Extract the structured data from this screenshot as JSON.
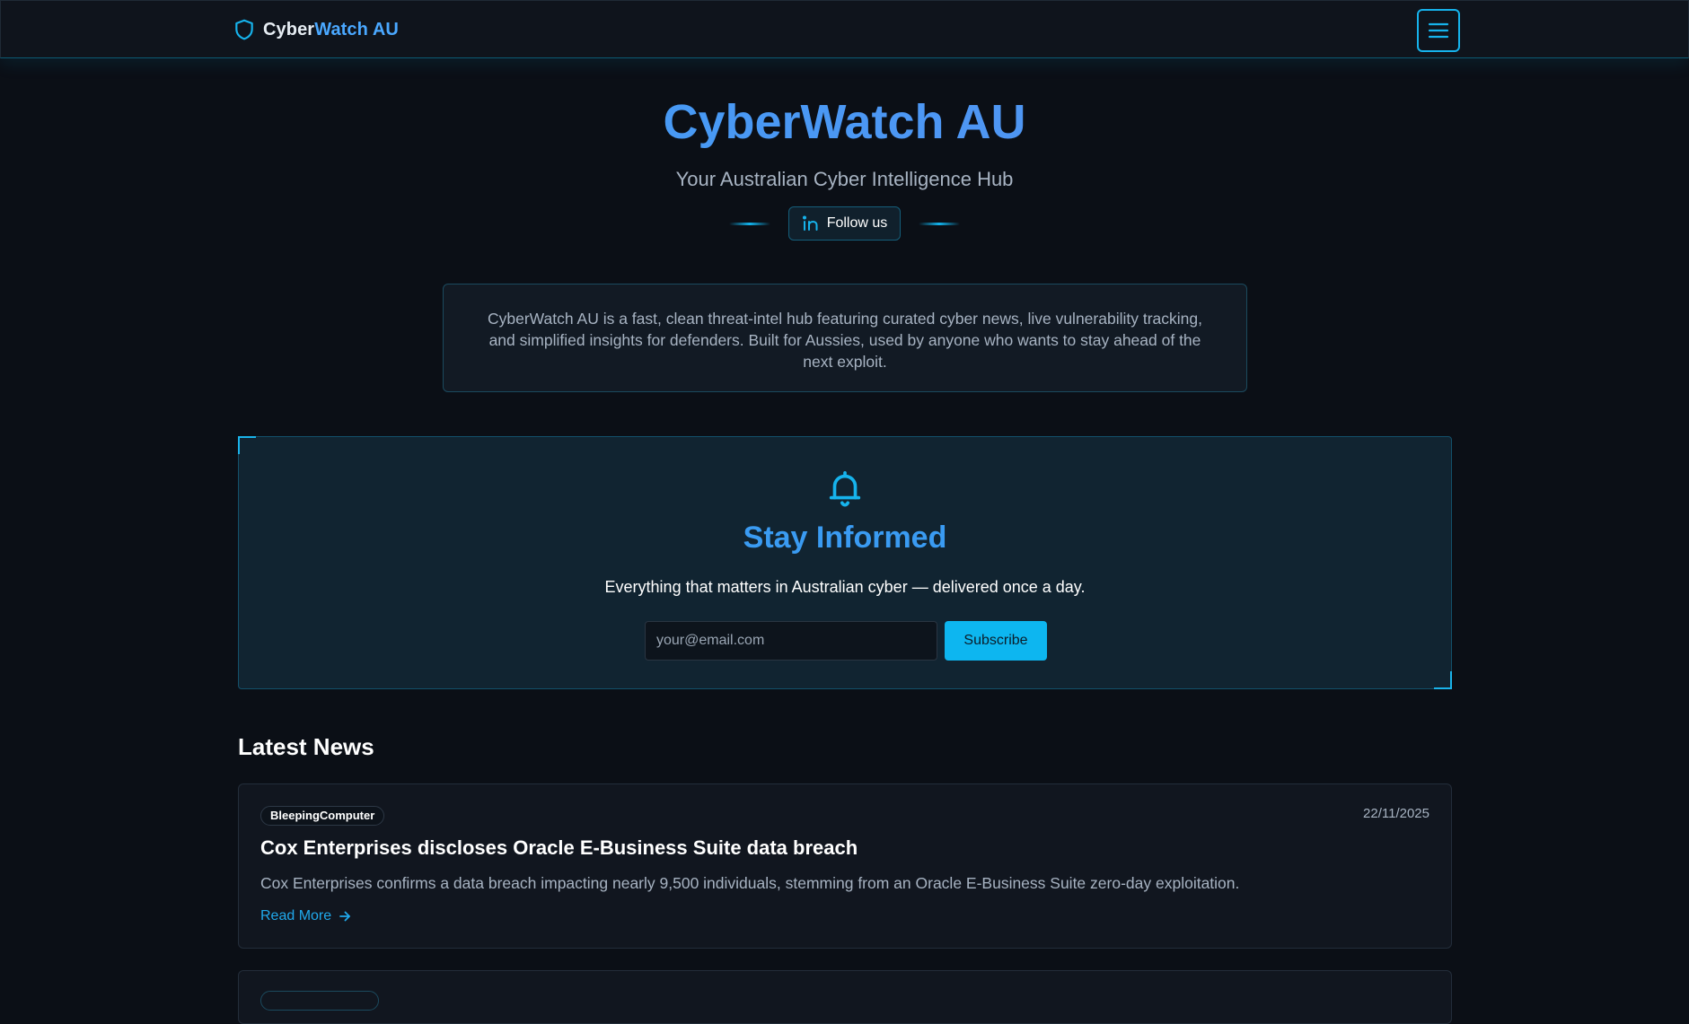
{
  "navbar": {
    "brand_part1": "Cyber",
    "brand_part2": "Watch AU",
    "menu_icon": "hamburger-menu-icon"
  },
  "hero": {
    "title": "CyberWatch AU",
    "subtitle": "Your Australian Cyber Intelligence Hub",
    "follow_label": "Follow us",
    "follow_icon": "linkedin-icon"
  },
  "about": {
    "text": "CyberWatch AU is a fast, clean threat-intel hub featuring curated cyber news, live vulnerability tracking, and simplified insights for defenders. Built for Aussies, used by anyone who wants to stay ahead of the next exploit."
  },
  "subscribe": {
    "icon": "bell-icon",
    "title": "Stay Informed",
    "description": "Everything that matters in Australian cyber — delivered once a day.",
    "email_placeholder": "your@email.com",
    "button_label": "Subscribe"
  },
  "news": {
    "heading": "Latest News",
    "items": [
      {
        "source": "BleepingComputer",
        "date": "22/11/2025",
        "title": "Cox Enterprises discloses Oracle E-Business Suite data breach",
        "summary": "Cox Enterprises confirms a data breach impacting nearly 9,500 individuals, stemming from an Oracle E-Business Suite zero-day exploitation.",
        "read_more": "Read More"
      }
    ]
  },
  "colors": {
    "accent": "#0db6f0",
    "title_blue": "#3a9bf2",
    "background": "#0b0f16",
    "card": "#11161f"
  }
}
